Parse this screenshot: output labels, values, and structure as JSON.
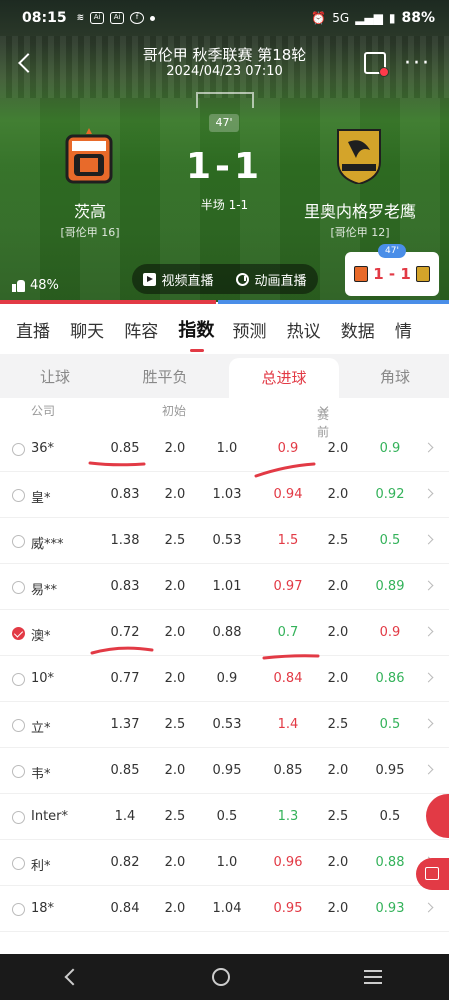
{
  "status_bar": {
    "time": "08:15",
    "network": "5G",
    "battery": "88%"
  },
  "header": {
    "title": "哥伦甲 秋季联赛 第18轮",
    "datetime": "2024/04/23 07:10"
  },
  "match": {
    "minute": "47'",
    "score": "1-1",
    "halftime": "半场 1-1",
    "home": {
      "name": "茨高",
      "rank": "[哥伦甲 16]"
    },
    "away": {
      "name": "里奥内格罗老鹰",
      "rank": "[哥伦甲 12]"
    },
    "likes": "48%",
    "live_video": "视频直播",
    "live_animation": "动画直播",
    "mini_score": "1 - 1",
    "mini_minute": "47'",
    "progress_home_fraction": 0.48
  },
  "colors": {
    "accent": "#e23a45",
    "up": "#e23a45",
    "down": "#34b25a",
    "blue": "#4a8ee8"
  },
  "tabs": [
    "直播",
    "聊天",
    "阵容",
    "指数",
    "预测",
    "热议",
    "数据",
    "情"
  ],
  "active_tab": "指数",
  "subtabs": [
    "让球",
    "胜平负",
    "总进球",
    "角球"
  ],
  "active_subtab": "总进球",
  "columns": {
    "company": "公司",
    "initial": "初始",
    "pre_match": "赛前"
  },
  "rows": [
    {
      "company": "36*",
      "i1": "0.85",
      "i2": "2.0",
      "i3": "1.0",
      "p1": "0.9",
      "p1c": "up",
      "p2": "2.0",
      "p3": "0.9",
      "p3c": "down",
      "checked": false
    },
    {
      "company": "皇*",
      "i1": "0.83",
      "i2": "2.0",
      "i3": "1.03",
      "p1": "0.94",
      "p1c": "up",
      "p2": "2.0",
      "p3": "0.92",
      "p3c": "down",
      "checked": false
    },
    {
      "company": "威***",
      "i1": "1.38",
      "i2": "2.5",
      "i3": "0.53",
      "p1": "1.5",
      "p1c": "up",
      "p2": "2.5",
      "p3": "0.5",
      "p3c": "down",
      "checked": false
    },
    {
      "company": "易**",
      "i1": "0.83",
      "i2": "2.0",
      "i3": "1.01",
      "p1": "0.97",
      "p1c": "up",
      "p2": "2.0",
      "p3": "0.89",
      "p3c": "down",
      "checked": false
    },
    {
      "company": "澳*",
      "i1": "0.72",
      "i2": "2.0",
      "i3": "0.88",
      "p1": "0.7",
      "p1c": "down",
      "p2": "2.0",
      "p3": "0.9",
      "p3c": "up",
      "checked": true
    },
    {
      "company": "10*",
      "i1": "0.77",
      "i2": "2.0",
      "i3": "0.9",
      "p1": "0.84",
      "p1c": "up",
      "p2": "2.0",
      "p3": "0.86",
      "p3c": "down",
      "checked": false
    },
    {
      "company": "立*",
      "i1": "1.37",
      "i2": "2.5",
      "i3": "0.53",
      "p1": "1.4",
      "p1c": "up",
      "p2": "2.5",
      "p3": "0.5",
      "p3c": "down",
      "checked": false
    },
    {
      "company": "韦*",
      "i1": "0.85",
      "i2": "2.0",
      "i3": "0.95",
      "p1": "0.85",
      "p1c": "",
      "p2": "2.0",
      "p3": "0.95",
      "p3c": "",
      "checked": false
    },
    {
      "company": "Inter*",
      "i1": "1.4",
      "i2": "2.5",
      "i3": "0.5",
      "p1": "1.3",
      "p1c": "down",
      "p2": "2.5",
      "p3": "0.5",
      "p3c": "",
      "checked": false
    },
    {
      "company": "利*",
      "i1": "0.82",
      "i2": "2.0",
      "i3": "1.0",
      "p1": "0.96",
      "p1c": "up",
      "p2": "2.0",
      "p3": "0.88",
      "p3c": "down",
      "checked": false
    },
    {
      "company": "18*",
      "i1": "0.84",
      "i2": "2.0",
      "i3": "1.04",
      "p1": "0.95",
      "p1c": "up",
      "p2": "2.0",
      "p3": "0.93",
      "p3c": "down",
      "checked": false
    }
  ]
}
